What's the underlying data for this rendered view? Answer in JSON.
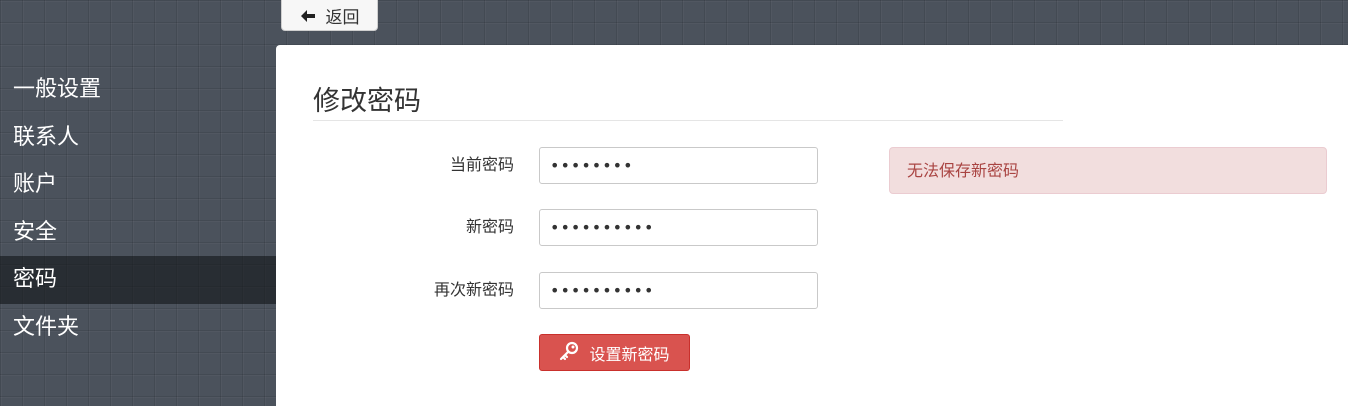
{
  "back_button": {
    "label": "返回",
    "icon": "arrow-left-icon"
  },
  "sidebar": {
    "items": [
      {
        "label": "一般设置"
      },
      {
        "label": "联系人"
      },
      {
        "label": "账户"
      },
      {
        "label": "安全"
      },
      {
        "label": "密码",
        "active": true
      },
      {
        "label": "文件夹"
      }
    ]
  },
  "main": {
    "title": "修改密码",
    "fields": [
      {
        "label": "当前密码",
        "value": "12345678",
        "type": "password"
      },
      {
        "label": "新密码",
        "value": "1234567890",
        "type": "password"
      },
      {
        "label": "再次新密码",
        "value": "1234567890",
        "type": "password"
      }
    ],
    "submit_label": "设置新密码",
    "submit_icon": "key-icon",
    "alert_text": "无法保存新密码"
  },
  "colors": {
    "danger": "#d9534f",
    "alert_bg": "#f2dede",
    "alert_text": "#a94442"
  }
}
